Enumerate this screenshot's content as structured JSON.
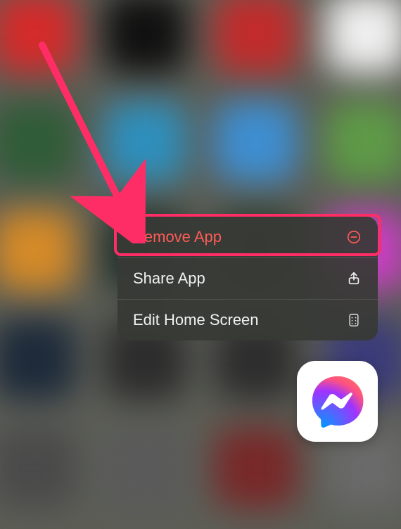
{
  "context_menu": {
    "items": [
      {
        "label": "Remove App",
        "style": "destructive",
        "icon": "minus-circle-icon"
      },
      {
        "label": "Share App",
        "style": "normal",
        "icon": "share-icon"
      },
      {
        "label": "Edit Home Screen",
        "style": "normal",
        "icon": "apps-grid-icon"
      }
    ]
  },
  "app": {
    "name": "Messenger"
  },
  "annotation": {
    "highlight": "ff2d66",
    "arrow_target": "Remove App"
  },
  "background_icons": [
    "#d52a2a",
    "#101010",
    "#c32b2b",
    "#efefef",
    "#2f5c37",
    "#2e8fbc",
    "#3e8ed0",
    "#5e9a47",
    "#d48a28",
    "#1f2e28",
    "#2a3a2e",
    "#c73fc1",
    "#1d2a3a",
    "#2c2c2c",
    "#2d2d2d",
    "#3b3b7a",
    "#4a4a4a",
    "#5a5a5a",
    "#782828",
    "#6a6a6a"
  ]
}
